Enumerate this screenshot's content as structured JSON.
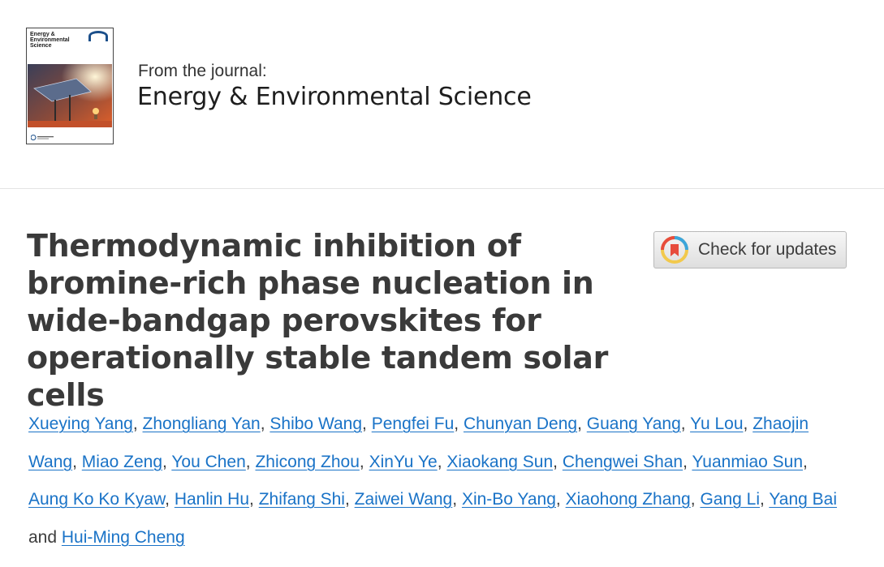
{
  "journal": {
    "from_label": "From the journal:",
    "name": "Energy & Environmental Science",
    "cover": {
      "title_lines": [
        "Energy &",
        "Environmental",
        "Science"
      ],
      "accent_color": "#e0602a"
    }
  },
  "article": {
    "title_lines": [
      "Thermodynamic inhibition of",
      "bromine-rich phase nucleation in",
      "wide-bandgap perovskites for",
      "operationally stable tandem solar cells"
    ]
  },
  "updates_button": {
    "label": "Check for updates",
    "icon": "crossmark-icon"
  },
  "authors": {
    "list": [
      "Xueying Yang",
      "Zhongliang Yan",
      "Shibo Wang",
      "Pengfei Fu",
      "Chunyan Deng",
      "Guang Yang",
      "Yu Lou",
      "Zhaojin Wang",
      "Miao Zeng",
      "You Chen",
      "Zhicong Zhou",
      "XinYu Ye",
      "Xiaokang Sun",
      "Chengwei Shan",
      "Yuanmiao Sun",
      "Aung Ko Ko Kyaw",
      "Hanlin Hu",
      "Zhifang Shi",
      "Zaiwei Wang",
      "Xin-Bo Yang",
      "Xiaohong Zhang",
      "Gang Li",
      "Yang Bai",
      "Hui-Ming Cheng"
    ],
    "separator": ",",
    "conjunction": "and"
  },
  "colors": {
    "link": "#1a73c7",
    "title": "#3a3a3a"
  }
}
